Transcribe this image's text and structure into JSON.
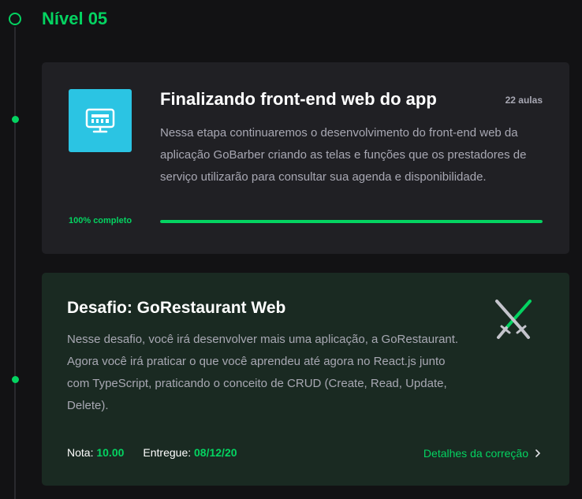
{
  "level": {
    "title": "Nível 05"
  },
  "module": {
    "icon": "monitor-icon",
    "title": "Finalizando front-end web do app",
    "lesson_count": "22 aulas",
    "description": "Nessa etapa continuaremos o desenvolvimento do front-end web da aplicação GoBarber criando as telas e funções que os prestadores de serviço utilizarão para consultar sua agenda e disponibilidade.",
    "progress_label": "100% completo",
    "progress_percent": 100
  },
  "challenge": {
    "icon": "crossed-swords-icon",
    "title": "Desafio: GoRestaurant Web",
    "description": "Nesse desafio, você irá desenvolver mais uma aplicação, a GoRestaurant. Agora você irá praticar o que você aprendeu até agora no React.js junto com TypeScript, praticando o conceito de CRUD (Create, Read, Update, Delete).",
    "grade_label": "Nota:",
    "grade_value": "10.00",
    "delivered_label": "Entregue:",
    "delivered_value": "08/12/20",
    "details_link": "Detalhes da correção"
  },
  "colors": {
    "accent": "#04d361",
    "module_icon_bg": "#2bc4e3",
    "card_bg": "#202024",
    "challenge_bg": "#1a2a22",
    "page_bg": "#121214"
  }
}
